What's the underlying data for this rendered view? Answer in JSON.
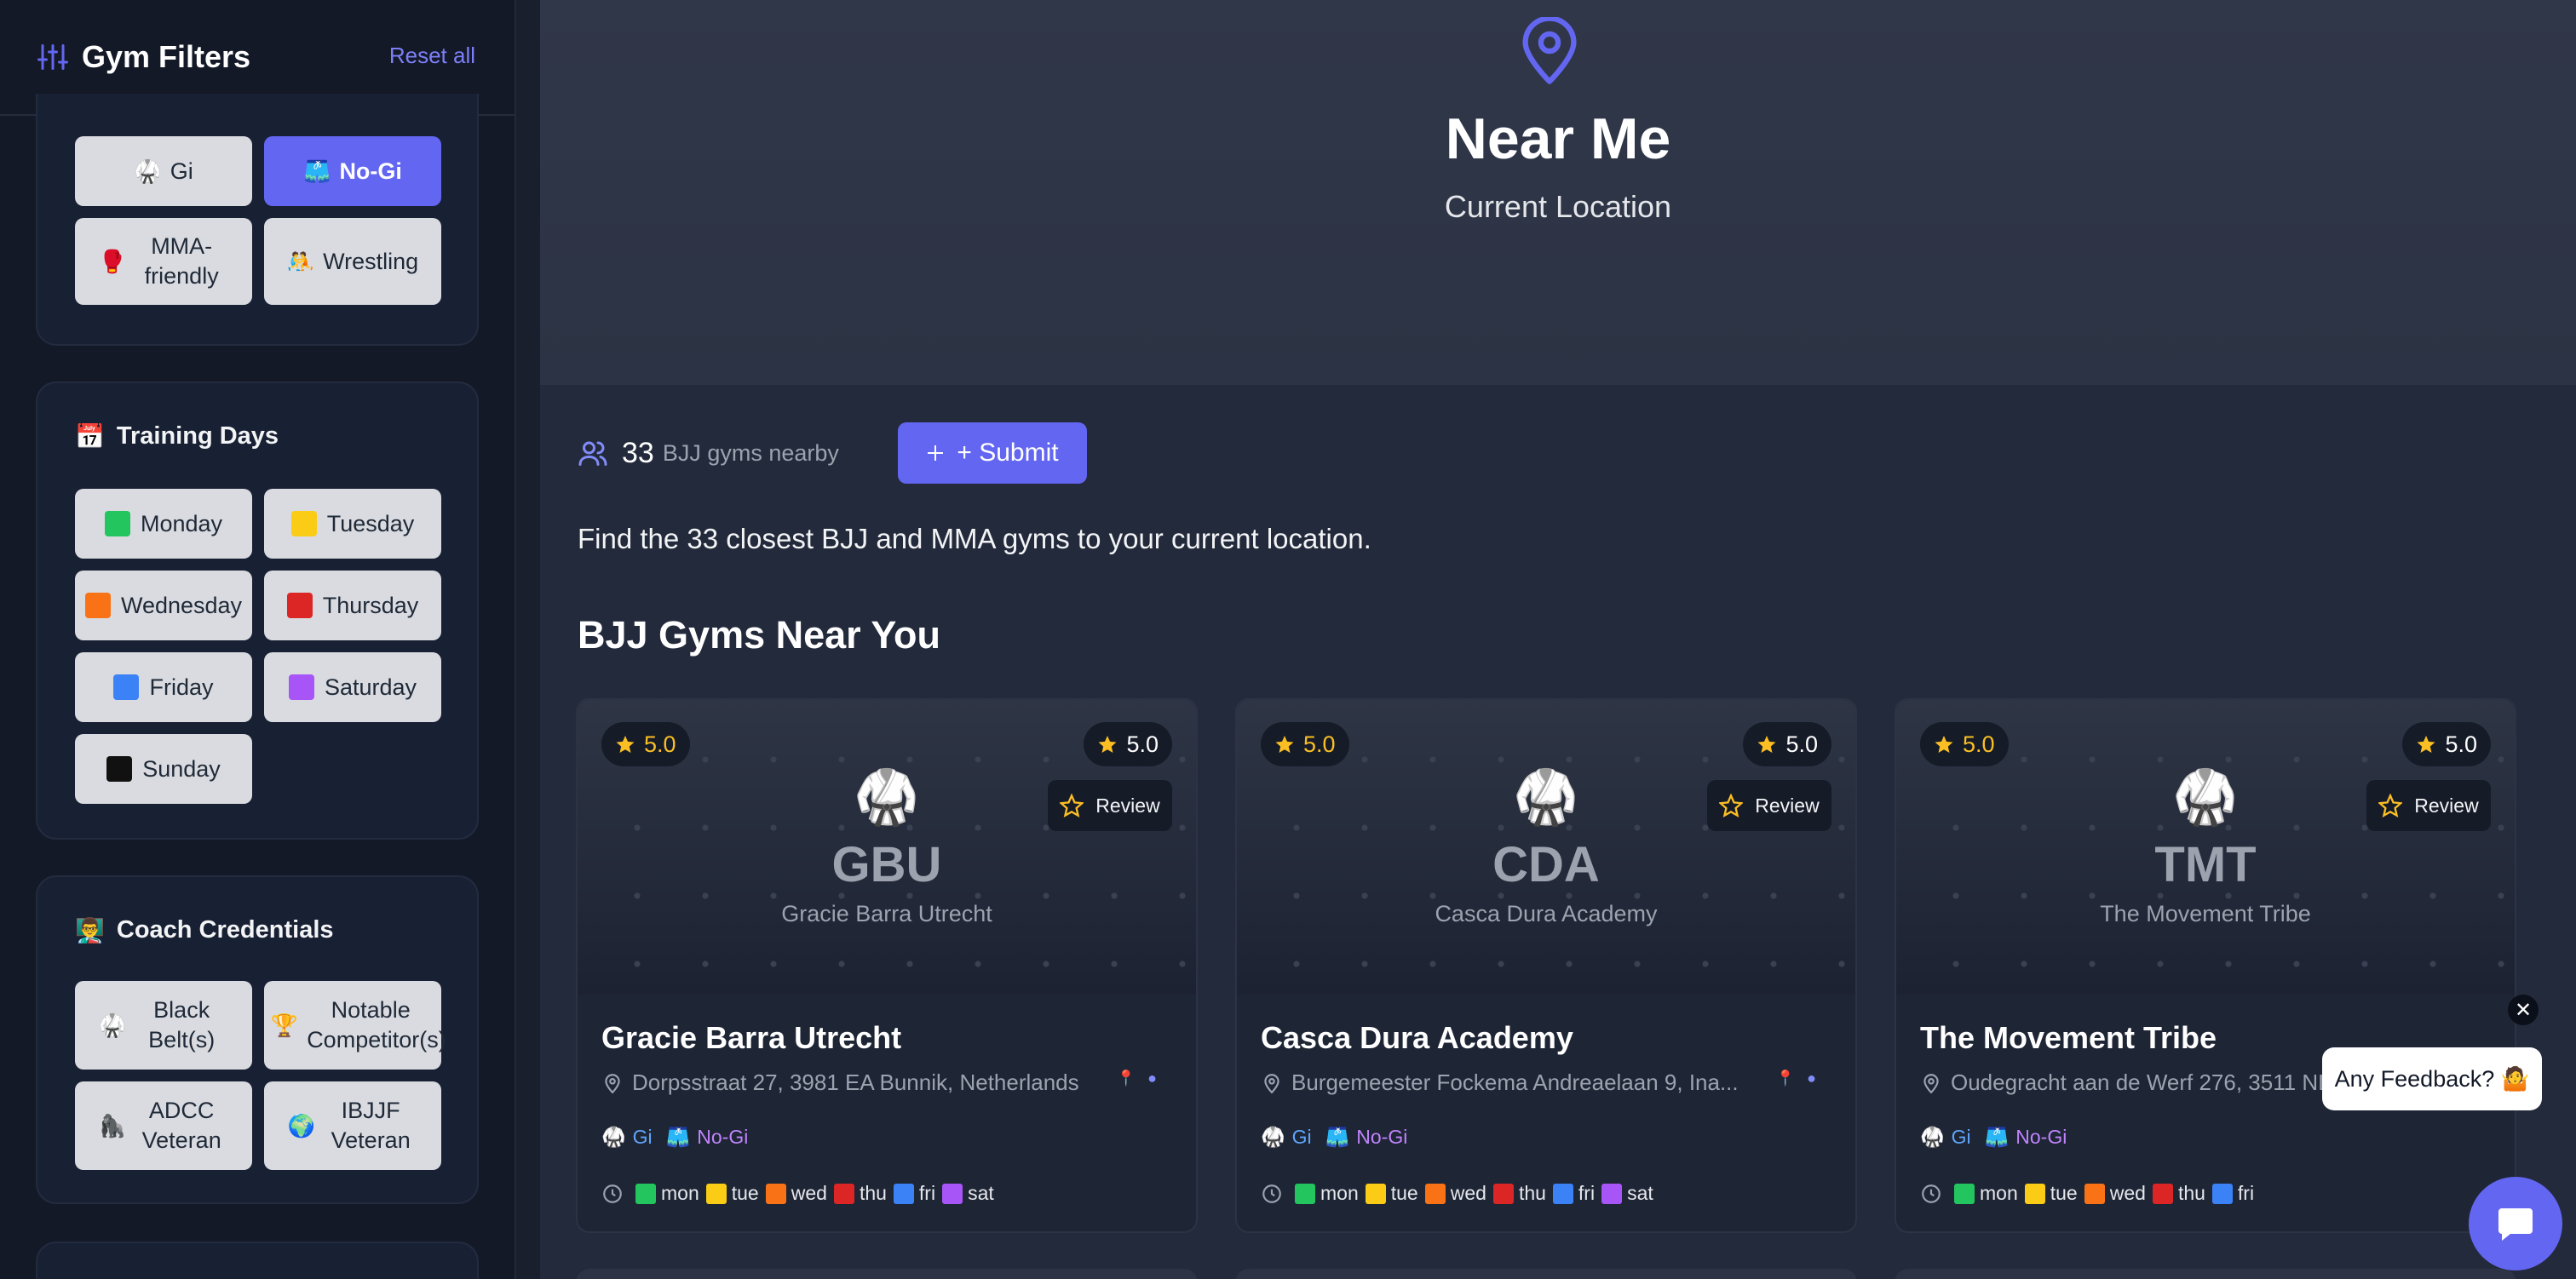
{
  "sidebar": {
    "title": "Gym Filters",
    "reset_label": "Reset all",
    "style_chips": [
      {
        "emoji": "🥋",
        "label": "Gi",
        "active": false
      },
      {
        "emoji": "🩳",
        "label": "No-Gi",
        "active": true
      },
      {
        "emoji": "🥊",
        "label": "MMA-friendly",
        "active": false
      },
      {
        "emoji": "🤼",
        "label": "Wrestling",
        "active": false
      }
    ],
    "training_days": {
      "emoji": "📅",
      "title": "Training Days",
      "days": [
        {
          "label": "Monday",
          "color": "#22c55e"
        },
        {
          "label": "Tuesday",
          "color": "#facc15"
        },
        {
          "label": "Wednesday",
          "color": "#f97316"
        },
        {
          "label": "Thursday",
          "color": "#dc2626"
        },
        {
          "label": "Friday",
          "color": "#3b82f6"
        },
        {
          "label": "Saturday",
          "color": "#a855f7"
        },
        {
          "label": "Sunday",
          "color": "#111111"
        }
      ]
    },
    "coach_credentials": {
      "emoji": "👨‍🏫",
      "title": "Coach Credentials",
      "items": [
        {
          "emoji": "🥋",
          "label": "Black Belt(s)"
        },
        {
          "emoji": "🏆",
          "label": "Notable Competitor(s)"
        },
        {
          "emoji": "🦍",
          "label": "ADCC Veteran"
        },
        {
          "emoji": "🌍",
          "label": "IBJJF Veteran"
        }
      ]
    }
  },
  "hero": {
    "title": "Near Me",
    "subtitle": "Current Location"
  },
  "summary": {
    "count": "33",
    "count_label": "BJJ gyms nearby",
    "submit_label": "+ Submit"
  },
  "intro_text": "Find the 33 closest BJJ and MMA gyms to your current location.",
  "section_title": "BJJ Gyms Near You",
  "cards": [
    {
      "rating_left": "5.0",
      "rating_right": "5.0",
      "review_label": "Review",
      "abbr": "GBU",
      "banner_name": "Gracie Barra Utrecht",
      "name": "Gracie Barra Utrecht",
      "address": "Dorpsstraat 27, 3981 EA Bunnik, Netherlands",
      "styles": [
        "Gi",
        "No-Gi"
      ],
      "days": [
        "mon",
        "tue",
        "wed",
        "thu",
        "fri",
        "sat"
      ]
    },
    {
      "rating_left": "5.0",
      "rating_right": "5.0",
      "review_label": "Review",
      "abbr": "CDA",
      "banner_name": "Casca Dura Academy",
      "name": "Casca Dura Academy",
      "address": "Burgemeester Fockema Andreaelaan 9, Ina...",
      "styles": [
        "Gi",
        "No-Gi"
      ],
      "days": [
        "mon",
        "tue",
        "wed",
        "thu",
        "fri",
        "sat"
      ]
    },
    {
      "rating_left": "5.0",
      "rating_right": "5.0",
      "review_label": "Review",
      "abbr": "TMT",
      "banner_name": "The Movement Tribe",
      "name": "The Movement Tribe",
      "address": "Oudegracht aan de Werf 276, 3511 NL",
      "styles": [
        "Gi",
        "No-Gi"
      ],
      "days": [
        "mon",
        "tue",
        "wed",
        "thu",
        "fri"
      ]
    }
  ],
  "day_colors": {
    "mon": "#22c55e",
    "tue": "#facc15",
    "wed": "#f97316",
    "thu": "#dc2626",
    "fri": "#3b82f6",
    "sat": "#a855f7"
  },
  "feedback": {
    "label": "Any Feedback? 🤷",
    "close": "✕"
  },
  "colors": {
    "accent": "#6366f1",
    "star": "#fbbf24"
  }
}
